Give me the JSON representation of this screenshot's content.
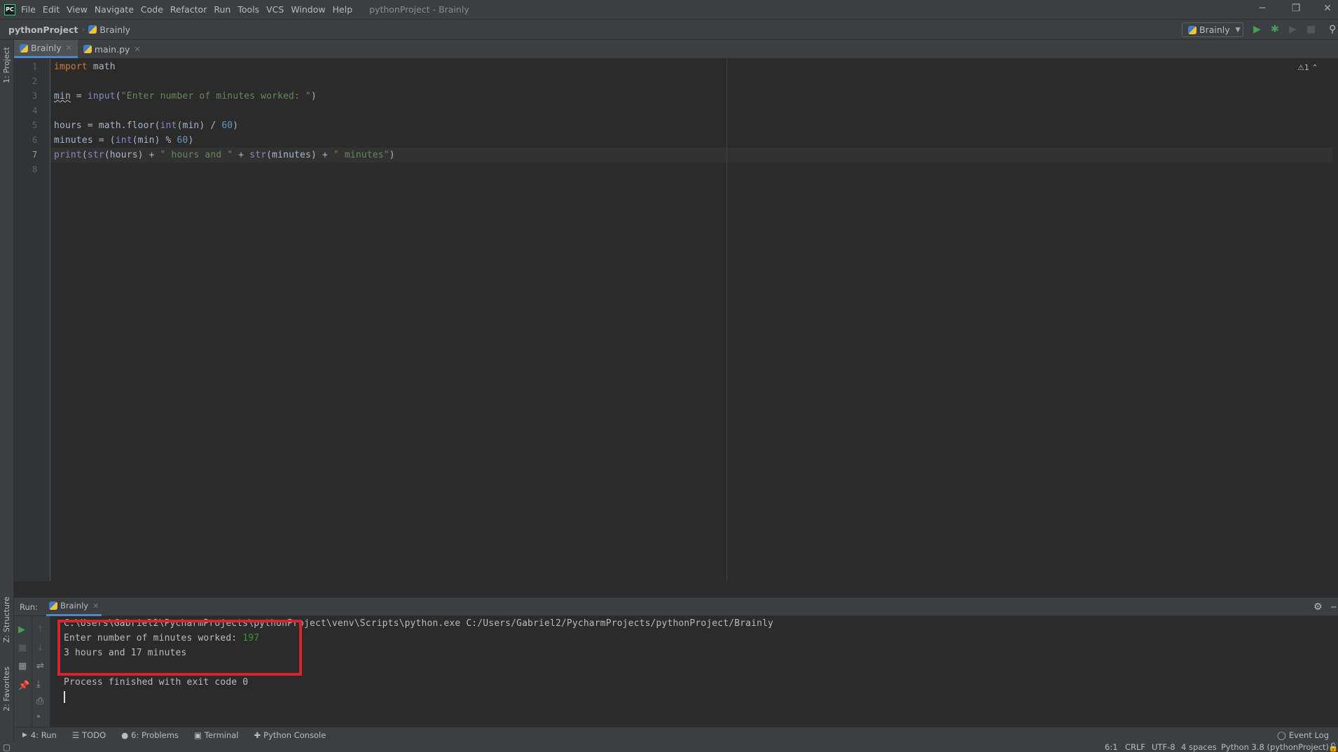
{
  "menubar": {
    "logo": "PC",
    "items": [
      "File",
      "Edit",
      "View",
      "Navigate",
      "Code",
      "Refactor",
      "Run",
      "Tools",
      "VCS",
      "Window",
      "Help"
    ],
    "title": "pythonProject - Brainly"
  },
  "navbar": {
    "project": "pythonProject",
    "file": "Brainly",
    "run_config": "Brainly"
  },
  "tabs": [
    {
      "label": "Brainly",
      "active": true
    },
    {
      "label": "main.py",
      "active": false
    }
  ],
  "left_stripe": {
    "project": "1: Project",
    "structure": "Z: Structure",
    "favorites": "2: Favorites"
  },
  "editor": {
    "warnings": "1",
    "current_line": 7,
    "lines": [
      [
        {
          "t": "import",
          "c": "kw"
        },
        {
          "t": " math",
          "c": "id"
        }
      ],
      [],
      [
        {
          "t": "min",
          "c": "id warn"
        },
        {
          "t": " = ",
          "c": "id"
        },
        {
          "t": "input",
          "c": "bi"
        },
        {
          "t": "(",
          "c": "id"
        },
        {
          "t": "\"Enter number of minutes worked: \"",
          "c": "str"
        },
        {
          "t": ")",
          "c": "id"
        }
      ],
      [],
      [
        {
          "t": "hours = math.floor(",
          "c": "id"
        },
        {
          "t": "int",
          "c": "bi"
        },
        {
          "t": "(min) / ",
          "c": "id"
        },
        {
          "t": "60",
          "c": "num"
        },
        {
          "t": ")",
          "c": "id"
        }
      ],
      [
        {
          "t": "minutes = (",
          "c": "id"
        },
        {
          "t": "int",
          "c": "bi"
        },
        {
          "t": "(min) % ",
          "c": "id"
        },
        {
          "t": "60",
          "c": "num"
        },
        {
          "t": ")",
          "c": "id"
        }
      ],
      [
        {
          "t": "print",
          "c": "bi"
        },
        {
          "t": "(",
          "c": "id"
        },
        {
          "t": "str",
          "c": "bi"
        },
        {
          "t": "(hours) + ",
          "c": "id"
        },
        {
          "t": "\" hours and \"",
          "c": "str"
        },
        {
          "t": " + ",
          "c": "id"
        },
        {
          "t": "str",
          "c": "bi"
        },
        {
          "t": "(minutes) + ",
          "c": "id"
        },
        {
          "t": "\" minutes\"",
          "c": "str"
        },
        {
          "t": ")",
          "c": "id"
        }
      ],
      []
    ]
  },
  "run": {
    "label": "Run:",
    "tab": "Brainly",
    "console": {
      "command": "C:\\Users\\Gabriel2\\PycharmProjects\\pythonProject\\venv\\Scripts\\python.exe C:/Users/Gabriel2/PycharmProjects/pythonProject/Brainly",
      "prompt": "Enter number of minutes worked: ",
      "input": "197",
      "output": "3 hours and 17 minutes",
      "exit": "Process finished with exit code 0"
    },
    "highlight_color": "#d8242a"
  },
  "tool_tabs": [
    "4: Run",
    "TODO",
    "6: Problems",
    "Terminal",
    "Python Console"
  ],
  "event_log": "Event Log",
  "status": {
    "position": "6:1",
    "line_sep": "CRLF",
    "encoding": "UTF-8",
    "indent": "4 spaces",
    "interpreter": "Python 3.8 (pythonProject)"
  }
}
